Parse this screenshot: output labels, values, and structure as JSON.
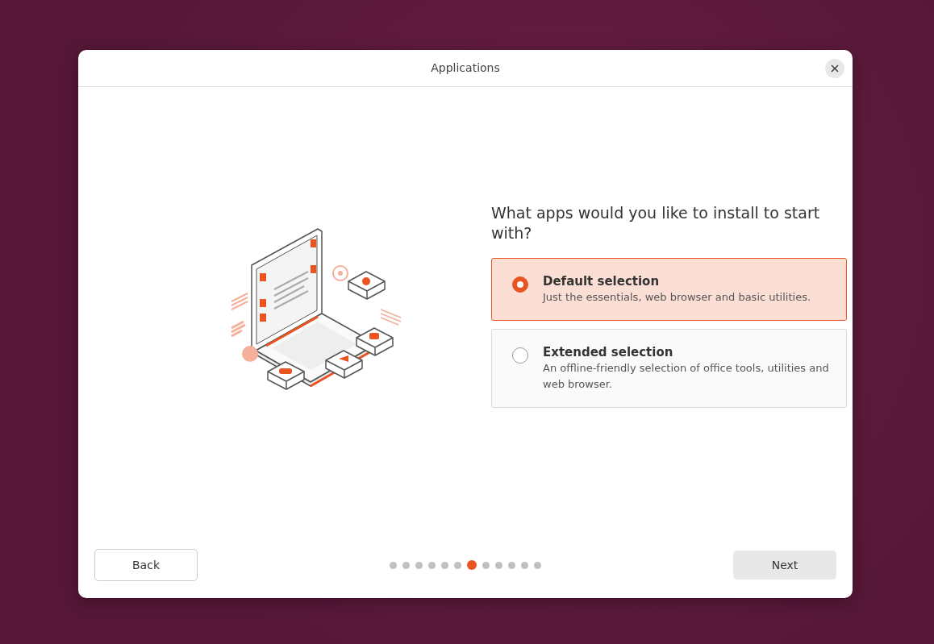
{
  "window": {
    "title": "Applications"
  },
  "question": "What apps would you like to install to start with?",
  "options": [
    {
      "title": "Default selection",
      "description": "Just the essentials, web browser and basic utilities.",
      "selected": true
    },
    {
      "title": "Extended selection",
      "description": "An offline-friendly selection of office tools, utilities and web browser.",
      "selected": false
    }
  ],
  "pager": [
    {
      "selected": false
    },
    {
      "selected": false
    },
    {
      "selected": false
    },
    {
      "selected": false
    },
    {
      "selected": false
    },
    {
      "selected": false
    },
    {
      "selected": true
    },
    {
      "selected": false
    },
    {
      "selected": false
    },
    {
      "selected": false
    },
    {
      "selected": false
    },
    {
      "selected": false
    }
  ],
  "buttons": {
    "back": "Back",
    "next": "Next"
  }
}
